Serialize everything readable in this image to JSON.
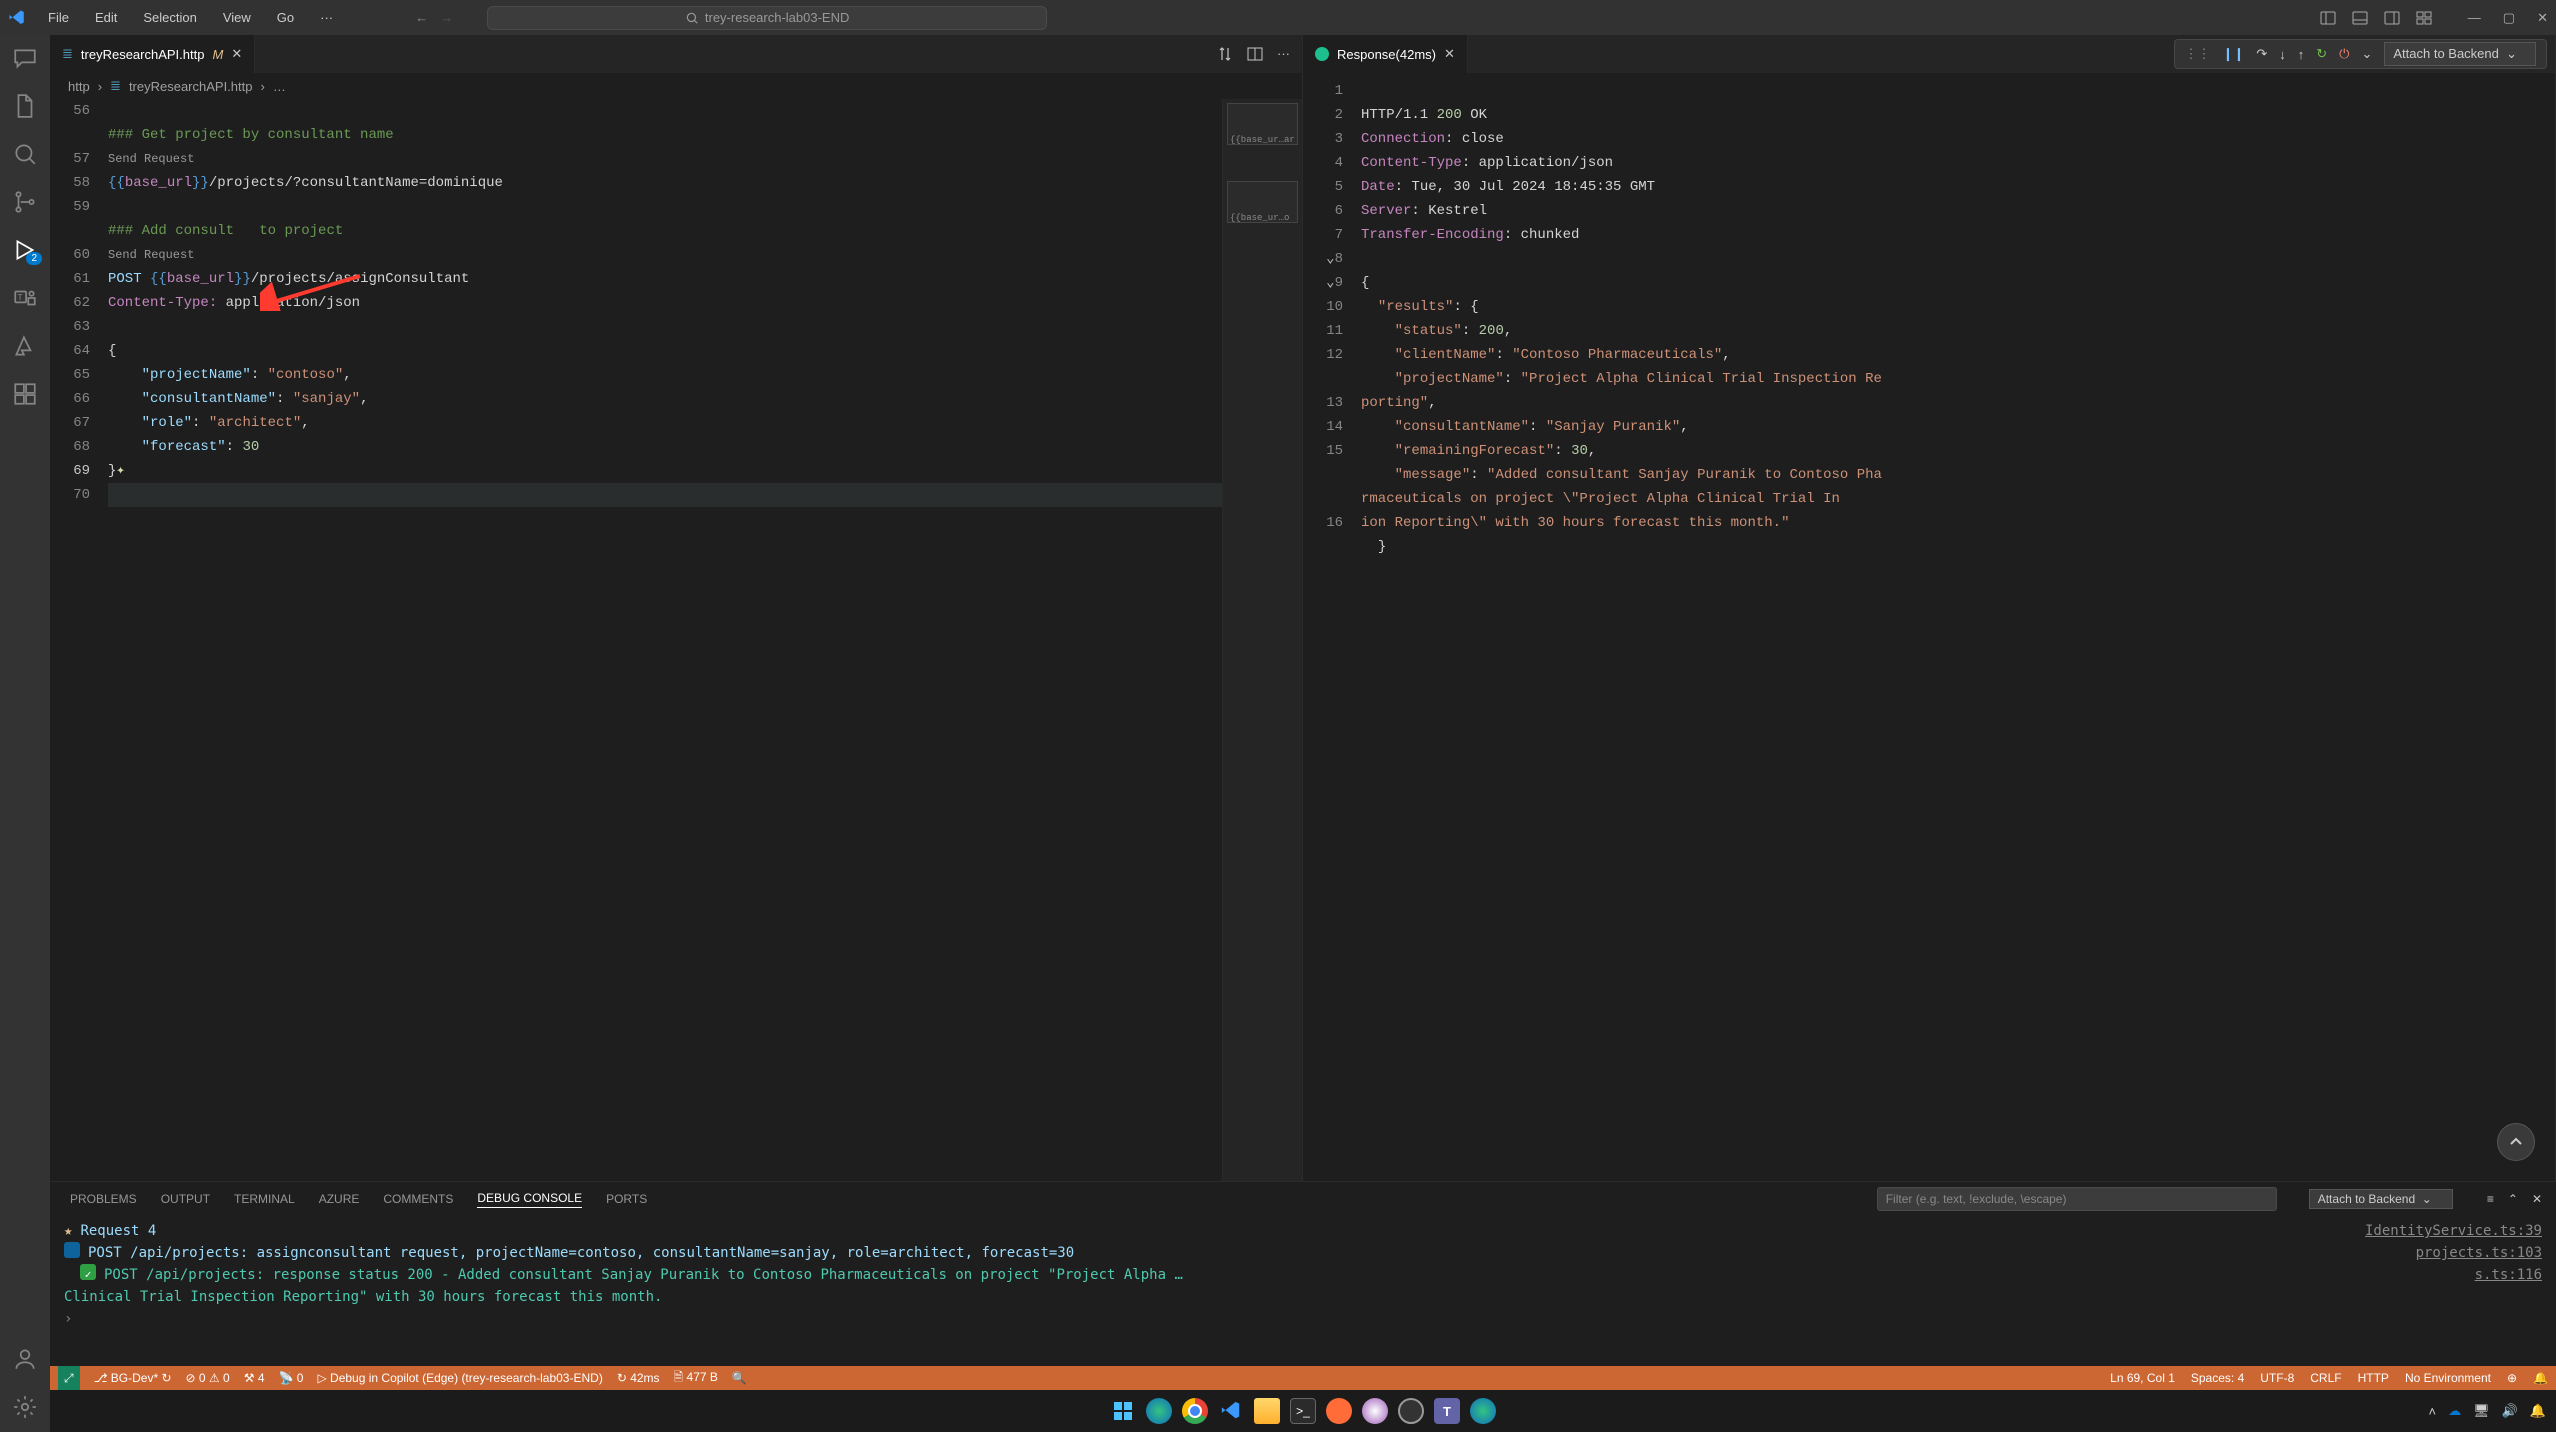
{
  "titlebar": {
    "menus": [
      "File",
      "Edit",
      "Selection",
      "View",
      "Go"
    ],
    "search_placeholder": "trey-research-lab03-END"
  },
  "activity": {
    "run_badge": "2"
  },
  "left_editor": {
    "tab_name": "treyResearchAPI.http",
    "tab_dirty_marker": "M",
    "breadcrumb_root": "http",
    "breadcrumb_file": "treyResearchAPI.http",
    "breadcrumb_rest": "…",
    "line_numbers": [
      "56",
      "57",
      "58",
      "59",
      "60",
      "61",
      "62",
      "63",
      "64",
      "65",
      "66",
      "67",
      "68",
      "69",
      "70"
    ],
    "codelens1": "Send Request",
    "codelens2": "Send Request",
    "comment1": "### Get project by consultant name",
    "url1_pre": "{{",
    "url1_var": "base_url",
    "url1_post": "}}",
    "url1_path": "/projects/?consultantName=dominique",
    "comment2_a": "### Add consult",
    "comment2_b": "   to project",
    "method": "POST",
    "url2_pre": "{{",
    "url2_var": "base_url",
    "url2_post": "}}",
    "url2_path": "/projects/assignConsultant",
    "header_key": "Content-Type:",
    "header_val": " application/json",
    "body": {
      "open": "{",
      "k1": "\"projectName\"",
      "v1": "\"contoso\"",
      "k2": "\"consultantName\"",
      "v2": "\"sanjay\"",
      "k3": "\"role\"",
      "v3": "\"architect\"",
      "k4": "\"forecast\"",
      "v4": "30",
      "close": "}"
    },
    "minimap_label1": "{{base_ur…ar",
    "minimap_label2": "{{base_ur…o"
  },
  "right_editor": {
    "tab_name": "Response(42ms)",
    "debug_config": "Attach to Backend",
    "line_numbers": [
      "1",
      "2",
      "3",
      "4",
      "5",
      "6",
      "7",
      "8",
      "9",
      "10",
      "11",
      "12",
      "13",
      "14",
      "15",
      "16"
    ],
    "l1_a": "HTTP/1.1 ",
    "l1_b": "200",
    "l1_c": " OK",
    "l2_a": "Connection",
    "l2_b": ": close",
    "l3_a": "Content-Type",
    "l3_b": ": application/json",
    "l4_a": "Date",
    "l4_b": ": Tue, 30 Jul 2024 18:45:35 GMT",
    "l5_a": "Server",
    "l5_b": ": Kestrel",
    "l6_a": "Transfer-Encoding",
    "l6_b": ": chunked",
    "l8": "{",
    "l9_k": "\"results\"",
    "l9_v": ": {",
    "l10_k": "\"status\"",
    "l10_v": "200",
    "l10_c": ",",
    "l11_k": "\"clientName\"",
    "l11_v": "\"Contoso Pharmaceuticals\"",
    "l11_c": ",",
    "l12_k": "\"projectName\"",
    "l12_v": "\"Project Alpha Clinical Trial Inspection Re",
    "l12b": "porting\"",
    "l12b_c": ",",
    "l13_k": "\"consultantName\"",
    "l13_v": "\"Sanjay Puranik\"",
    "l13_c": ",",
    "l14_k": "\"remainingForecast\"",
    "l14_v": "30",
    "l14_c": ",",
    "l15_k": "\"message\"",
    "l15_v": "\"Added consultant Sanjay Puranik to Contoso Pha",
    "l15b": "rmaceuticals on project \\\"Project Alpha Clinical Trial In",
    "l15c": "ion Reporting\\\" with 30 hours forecast this month.\"",
    "l16": "}"
  },
  "panel": {
    "tabs": [
      "PROBLEMS",
      "OUTPUT",
      "TERMINAL",
      "AZURE",
      "COMMENTS",
      "DEBUG CONSOLE",
      "PORTS"
    ],
    "active_tab": 5,
    "filter_placeholder": "Filter (e.g. text, !exclude, \\escape)",
    "select": "Attach to Backend",
    "log1": "Request 4",
    "log1_src": "IdentityService.ts:39",
    "log2": "POST /api/projects: assignconsultant request, projectName=contoso, consultantName=sanjay, role=architect, forecast=30",
    "log2_src": "projects.ts:103",
    "log3": "POST /api/projects: response status 200 - Added consultant Sanjay Puranik to Contoso Pharmaceuticals on project \"Project Alpha …",
    "log3_src": "s.ts:116",
    "log3b": "Clinical Trial Inspection Reporting\" with 30 hours forecast this month.",
    "prompt": "›"
  },
  "statusbar": {
    "branch": "BG-Dev*",
    "errors": "0",
    "warnings": "0",
    "forks": "4",
    "ports": "0",
    "debug_label": "Debug in Copilot (Edge) (trey-research-lab03-END)",
    "timing": "42ms",
    "size": "477 B",
    "cursor": "Ln 69, Col 1",
    "spaces": "Spaces: 4",
    "encoding": "UTF-8",
    "eol": "CRLF",
    "lang": "HTTP",
    "env": "No Environment"
  }
}
